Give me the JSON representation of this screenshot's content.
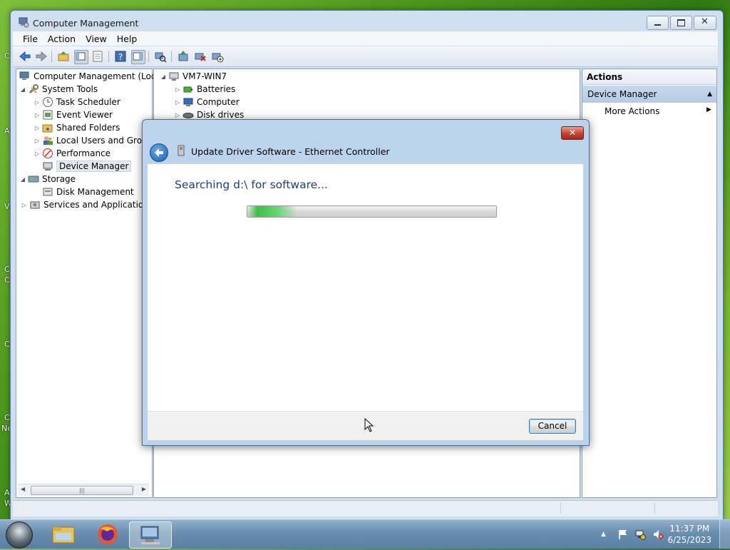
{
  "desktop": {
    "edge_glyphs": [
      "C",
      "A",
      "V",
      "C",
      "C",
      "C",
      "C",
      "Ne",
      "A",
      "W"
    ]
  },
  "window": {
    "title": "Computer Management",
    "menus": [
      "File",
      "Action",
      "View",
      "Help"
    ]
  },
  "left_tree": {
    "root": "Computer Management (Local",
    "items": [
      {
        "label": "System Tools"
      },
      {
        "label": "Task Scheduler"
      },
      {
        "label": "Event Viewer"
      },
      {
        "label": "Shared Folders"
      },
      {
        "label": "Local Users and Group"
      },
      {
        "label": "Performance"
      },
      {
        "label": "Device Manager"
      },
      {
        "label": "Storage"
      },
      {
        "label": "Disk Management"
      },
      {
        "label": "Services and Applications"
      }
    ]
  },
  "center_tree": {
    "root": "VM7-WIN7",
    "items": [
      "Batteries",
      "Computer",
      "Disk drives"
    ]
  },
  "actions": {
    "header": "Actions",
    "section": "Device Manager",
    "more": "More Actions"
  },
  "dialog": {
    "title": "Update Driver Software - Ethernet Controller",
    "heading": "Searching d:\\ for software...",
    "progress": 0.2,
    "cancel_label": "Cancel",
    "close_label": "✕"
  },
  "taskbar": {
    "time": "11:37 PM",
    "date": "6/25/2023"
  },
  "colors": {
    "accent": "#1e3f7a",
    "progress": "#3ec04a"
  }
}
